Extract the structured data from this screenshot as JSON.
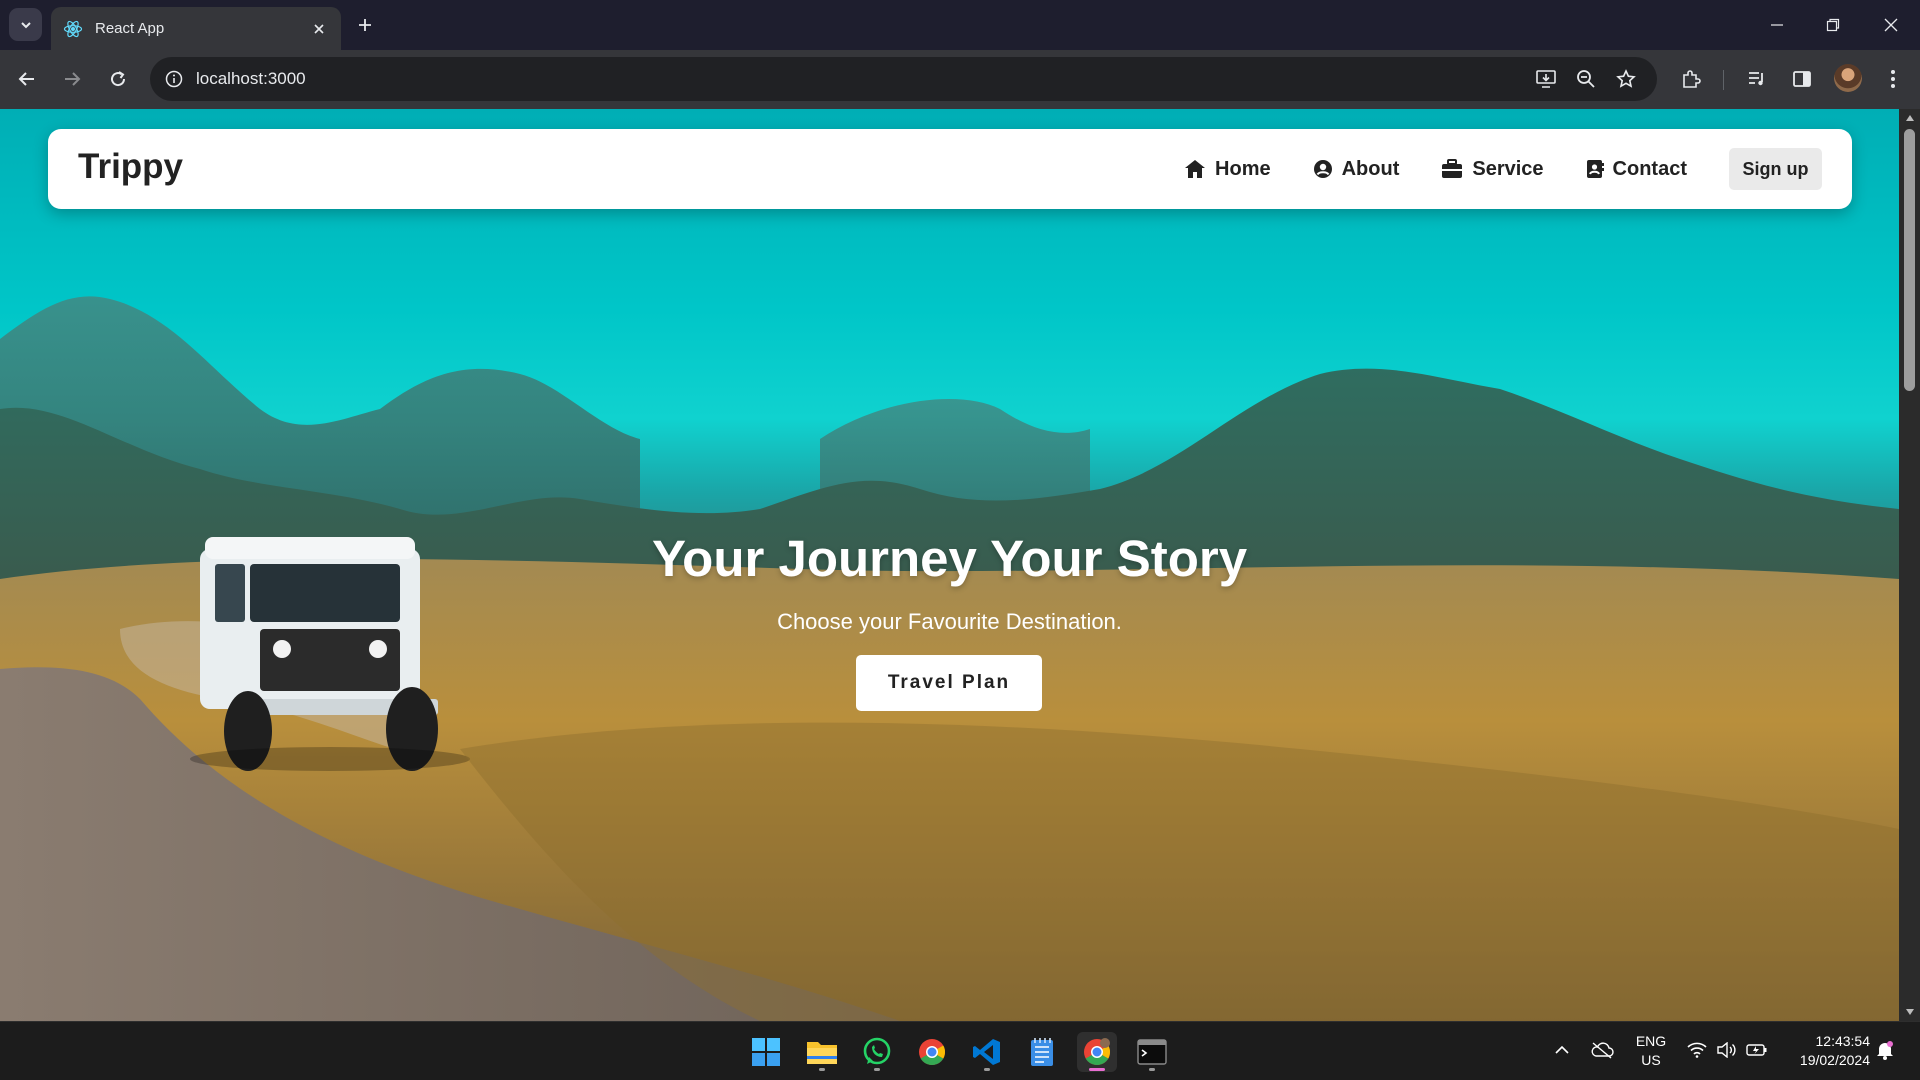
{
  "browser": {
    "tab_title": "React App",
    "url": "localhost:3000"
  },
  "navbar": {
    "brand": "Trippy",
    "links": [
      {
        "label": "Home",
        "icon": "home-icon"
      },
      {
        "label": "About",
        "icon": "user-circle-icon"
      },
      {
        "label": "Service",
        "icon": "briefcase-icon"
      },
      {
        "label": "Contact",
        "icon": "address-book-icon"
      }
    ],
    "signup": "Sign up"
  },
  "hero": {
    "title": "Your Journey Your Story",
    "subtitle": "Choose your Favourite Destination.",
    "button": "Travel Plan"
  },
  "taskbar": {
    "language": "ENG",
    "region": "US",
    "time": "12:43:54",
    "date": "19/02/2024"
  },
  "colors": {
    "sky": "#00c6c8",
    "browser_frame": "#1e1e2e",
    "toolbar": "#35363a",
    "taskbar": "#1c1c1c",
    "active_indicator": "#e86ed1"
  }
}
